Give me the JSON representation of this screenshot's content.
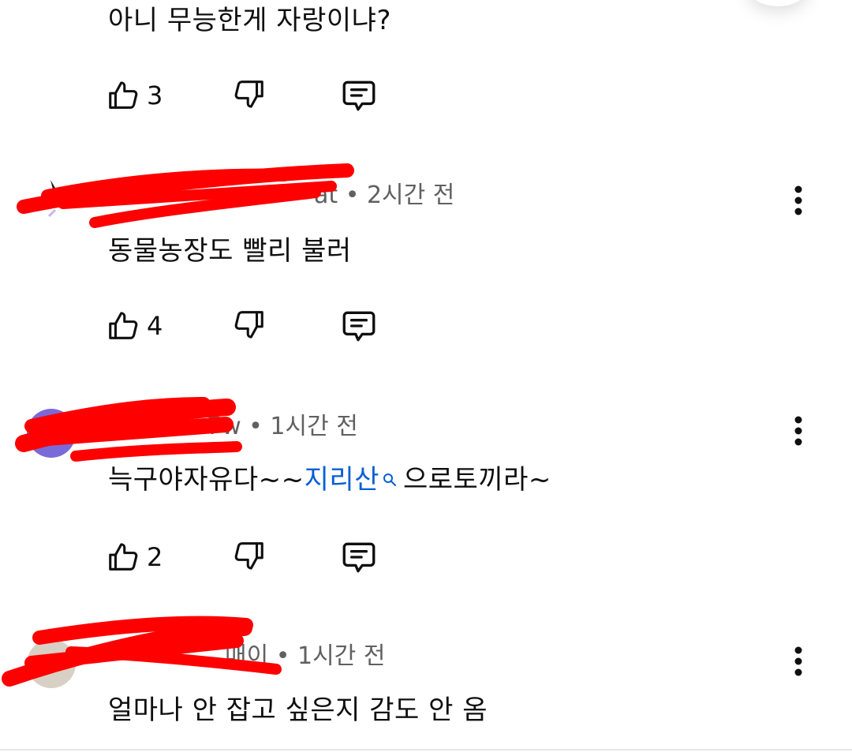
{
  "comments": [
    {
      "author_visible": "",
      "time": "",
      "text": "아니  무능한게 자랑이냐?",
      "likes": "3"
    },
    {
      "author_visible": "at",
      "time": "2시간 전",
      "text": "동물농장도 빨리  불러",
      "likes": "4"
    },
    {
      "author_visible": "7w",
      "time": "1시간 전",
      "text_before": "늑구야자유다~~",
      "link_text": "지리산",
      "text_after": "으로토끼라~",
      "likes": "2"
    },
    {
      "author_visible": "매이",
      "time": "1시간 전",
      "text": "얼마나 안 잡고 싶은지 감도 안 옴",
      "likes": ""
    }
  ],
  "separator": "•",
  "icons": {
    "like": "thumbs-up-icon",
    "dislike": "thumbs-down-icon",
    "reply": "reply-comment-icon",
    "more": "more-vertical-icon",
    "search": "search-icon"
  },
  "colors": {
    "link": "#065fd4",
    "meta": "#606060",
    "text": "#0f0f0f",
    "redaction": "#ff0000"
  }
}
